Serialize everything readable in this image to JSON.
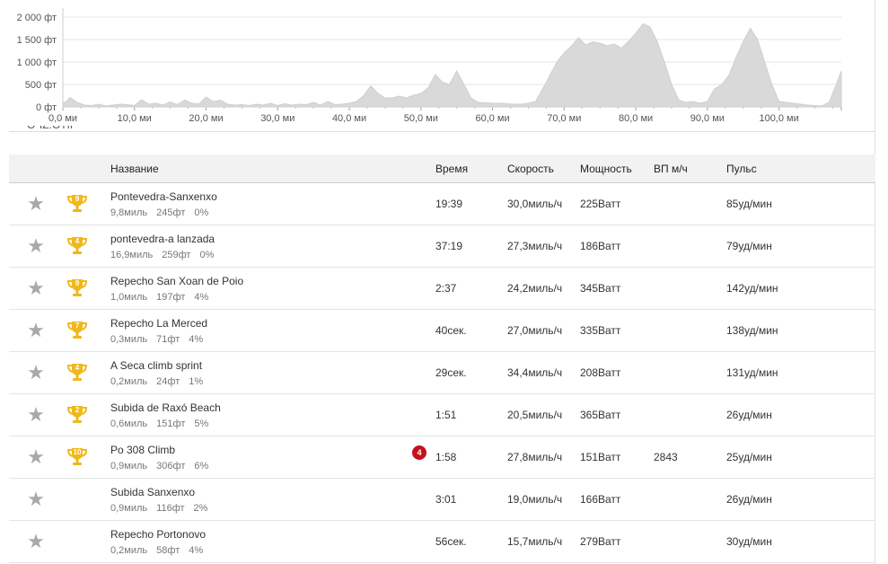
{
  "elevation": {
    "y_ticks": [
      "2 000 фт",
      "1 500 фт",
      "1 000 фт",
      "500 фт",
      "0 фт"
    ],
    "x_ticks": [
      "0,0 ми",
      "10,0 ми",
      "20,0 ми",
      "30,0 ми",
      "40,0 ми",
      "50,0 ми",
      "60,0 ми",
      "70,0 ми",
      "80,0 ми",
      "90,0 ми",
      "100,0 ми"
    ],
    "fill_color": "#d9d9d9"
  },
  "chart_data": {
    "type": "area",
    "title": "",
    "xlabel": "",
    "ylabel": "",
    "xlim": [
      0,
      108.7
    ],
    "ylim": [
      0,
      2000
    ],
    "grid": true,
    "legend": "none",
    "x": [
      0,
      0.5,
      1,
      2,
      3,
      4,
      5,
      6,
      7,
      8,
      9,
      10,
      11,
      12,
      13,
      14,
      15,
      16,
      17,
      18,
      19,
      20,
      21,
      22,
      23,
      24,
      25,
      26,
      27,
      28,
      29,
      30,
      31,
      32,
      33,
      34,
      35,
      36,
      37,
      38,
      39,
      40,
      41,
      42,
      43,
      44,
      45,
      46,
      47,
      48,
      49,
      50,
      51,
      52,
      53,
      54,
      55,
      56,
      57,
      58,
      59,
      60,
      61,
      62,
      63,
      64,
      65,
      66,
      67,
      68,
      69,
      70,
      71,
      72,
      73,
      74,
      75,
      76,
      77,
      78,
      79,
      80,
      81,
      82,
      83,
      84,
      85,
      86,
      87,
      88,
      89,
      90,
      91,
      92,
      93,
      94,
      95,
      96,
      97,
      98,
      99,
      100,
      101,
      102,
      103,
      104,
      105,
      106,
      107,
      108,
      108.7
    ],
    "y": [
      80,
      120,
      210,
      100,
      40,
      30,
      60,
      20,
      40,
      60,
      50,
      30,
      160,
      60,
      80,
      40,
      110,
      50,
      150,
      80,
      60,
      220,
      120,
      150,
      60,
      40,
      50,
      30,
      60,
      40,
      80,
      30,
      70,
      40,
      60,
      50,
      100,
      40,
      120,
      50,
      60,
      80,
      120,
      250,
      470,
      300,
      200,
      200,
      240,
      200,
      260,
      300,
      420,
      720,
      550,
      500,
      800,
      500,
      200,
      100,
      90,
      80,
      80,
      70,
      60,
      60,
      80,
      120,
      400,
      700,
      1000,
      1200,
      1350,
      1540,
      1380,
      1450,
      1420,
      1360,
      1400,
      1310,
      1460,
      1640,
      1850,
      1780,
      1450,
      1000,
      500,
      150,
      100,
      120,
      80,
      120,
      400,
      500,
      700,
      1100,
      1450,
      1750,
      1500,
      1000,
      500,
      120,
      100,
      80,
      60,
      40,
      30,
      20,
      100,
      500,
      800
    ],
    "series": [
      {
        "values_key": "y"
      }
    ]
  },
  "table": {
    "headers": {
      "name": "Название",
      "time": "Время",
      "speed": "Скорость",
      "power": "Мощность",
      "vam": "ВП м/ч",
      "hr": "Пульс"
    },
    "rows": [
      {
        "rank": "9",
        "name": "Pontevedra-Sanxenxo",
        "distance": "9,8миль",
        "elev": "245фт",
        "grade": "0%",
        "badge": "",
        "time": "19:39",
        "speed": "30,0миль/ч",
        "power": "225Ватт",
        "vam": "",
        "hr": "85уд/мин"
      },
      {
        "rank": "4",
        "name": "pontevedra-a lanzada",
        "distance": "16,9миль",
        "elev": "259фт",
        "grade": "0%",
        "badge": "",
        "time": "37:19",
        "speed": "27,3миль/ч",
        "power": "186Ватт",
        "vam": "",
        "hr": "79уд/мин"
      },
      {
        "rank": "9",
        "name": "Repecho San Xoan de Poio",
        "distance": "1,0миль",
        "elev": "197фт",
        "grade": "4%",
        "badge": "",
        "time": "2:37",
        "speed": "24,2миль/ч",
        "power": "345Ватт",
        "vam": "",
        "hr": "142уд/мин"
      },
      {
        "rank": "7",
        "name": "Repecho La Merced",
        "distance": "0,3миль",
        "elev": "71фт",
        "grade": "4%",
        "badge": "",
        "time": "40сек.",
        "speed": "27,0миль/ч",
        "power": "335Ватт",
        "vam": "",
        "hr": "138уд/мин"
      },
      {
        "rank": "4",
        "name": "A Seca climb sprint",
        "distance": "0,2миль",
        "elev": "24фт",
        "grade": "1%",
        "badge": "",
        "time": "29сек.",
        "speed": "34,4миль/ч",
        "power": "208Ватт",
        "vam": "",
        "hr": "131уд/мин"
      },
      {
        "rank": "2",
        "name": "Subida de Raxó Beach",
        "distance": "0,6миль",
        "elev": "151фт",
        "grade": "5%",
        "badge": "",
        "time": "1:51",
        "speed": "20,5миль/ч",
        "power": "365Ватт",
        "vam": "",
        "hr": "26уд/мин"
      },
      {
        "rank": "10",
        "name": "Po 308 Climb",
        "distance": "0,9миль",
        "elev": "306фт",
        "grade": "6%",
        "badge": "4",
        "time": "1:58",
        "speed": "27,8миль/ч",
        "power": "151Ватт",
        "vam": "2843",
        "hr": "25уд/мин"
      },
      {
        "rank": "",
        "name": "Subida Sanxenxo",
        "distance": "0,9миль",
        "elev": "116фт",
        "grade": "2%",
        "badge": "",
        "time": "3:01",
        "speed": "19,0миль/ч",
        "power": "166Ватт",
        "vam": "",
        "hr": "26уд/мин"
      },
      {
        "rank": "",
        "name": "Repecho Portonovo",
        "distance": "0,2миль",
        "elev": "58фт",
        "grade": "4%",
        "badge": "",
        "time": "56сек.",
        "speed": "15,7миль/ч",
        "power": "279Ватт",
        "vam": "",
        "hr": "30уд/мин"
      }
    ]
  },
  "colors": {
    "trophy": "#f0b81c",
    "star": "#a9a9a9",
    "badge": "#c4121b",
    "header_bg": "#f2f2f2"
  }
}
